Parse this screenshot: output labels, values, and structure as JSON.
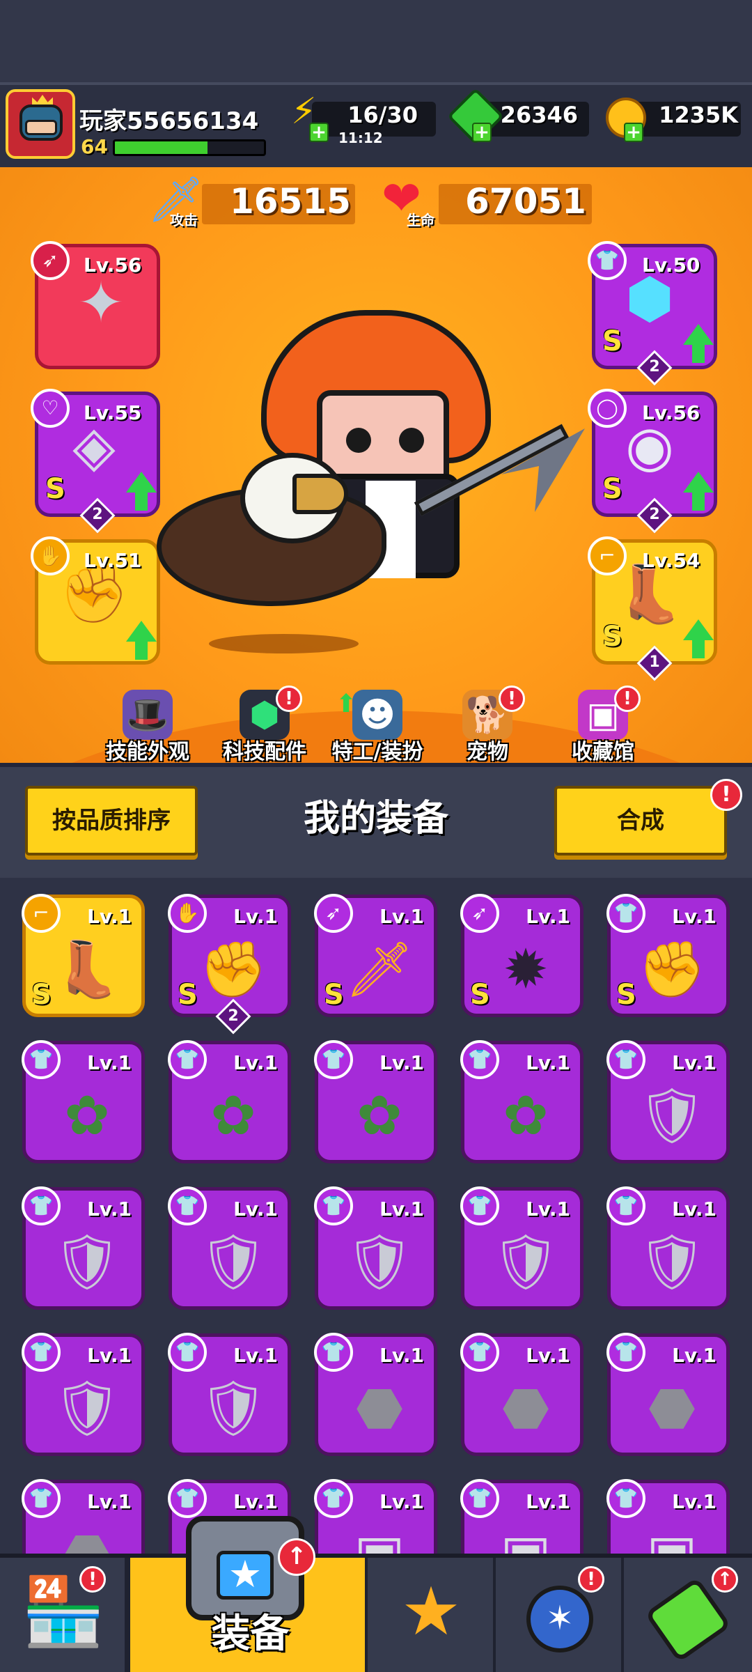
{
  "header": {
    "player_name": "玩家55656134",
    "player_level": "64",
    "xp_fraction": 0.62,
    "energy": "16/30",
    "energy_timer": "11:12",
    "gems": "26346",
    "coins": "1235K"
  },
  "stats": {
    "attack_value": "16515",
    "attack_label": "攻击",
    "health_value": "67051",
    "health_label": "生命"
  },
  "equipped": {
    "weapon": {
      "level": "Lv.56"
    },
    "necklace": {
      "level": "Lv.55",
      "grade": "S",
      "stars": "2"
    },
    "gloves": {
      "level": "Lv.51"
    },
    "armor": {
      "level": "Lv.50",
      "grade": "S",
      "stars": "2"
    },
    "belt": {
      "level": "Lv.56",
      "grade": "S",
      "stars": "2"
    },
    "boots": {
      "level": "Lv.54",
      "grade": "S",
      "stars": "1"
    }
  },
  "features": [
    {
      "label": "技能外观",
      "alert": ""
    },
    {
      "label": "科技配件",
      "alert": "!"
    },
    {
      "label": "特工/装扮",
      "alert": ""
    },
    {
      "label": "宠物",
      "alert": "!"
    },
    {
      "label": "收藏馆",
      "alert": "!"
    }
  ],
  "equipment_panel": {
    "sort_button": "按品质排序",
    "title": "我的装备",
    "merge_button": "合成",
    "merge_alert": "!"
  },
  "inventory": {
    "r0": [
      {
        "lv": "Lv.1",
        "grade": "S",
        "badge": ""
      },
      {
        "lv": "Lv.1",
        "grade": "S",
        "badge": "2"
      },
      {
        "lv": "Lv.1",
        "grade": "S",
        "badge": ""
      },
      {
        "lv": "Lv.1",
        "grade": "S",
        "badge": ""
      },
      {
        "lv": "Lv.1",
        "grade": "S",
        "badge": ""
      }
    ],
    "r1": [
      "Lv.1",
      "Lv.1",
      "Lv.1",
      "Lv.1",
      "Lv.1"
    ],
    "r2": [
      "Lv.1",
      "Lv.1",
      "Lv.1",
      "Lv.1",
      "Lv.1"
    ],
    "r3": [
      "Lv.1",
      "Lv.1",
      "Lv.1",
      "Lv.1",
      "Lv.1"
    ],
    "r4": [
      "Lv.1",
      "Lv.1",
      "Lv.1",
      "Lv.1",
      "Lv.1"
    ]
  },
  "bottom_nav": {
    "active_label": "装备",
    "shop_alert": "!",
    "pets_alert": "!",
    "active_alert": "↑",
    "lab_alert": "↑"
  },
  "colors": {
    "rarity_purple": "#a52bd8",
    "rarity_yellow": "#ffcf1f",
    "rarity_red": "#f23a5a",
    "accent_orange": "#ff9a1a",
    "button_yellow": "#ffd21a"
  }
}
